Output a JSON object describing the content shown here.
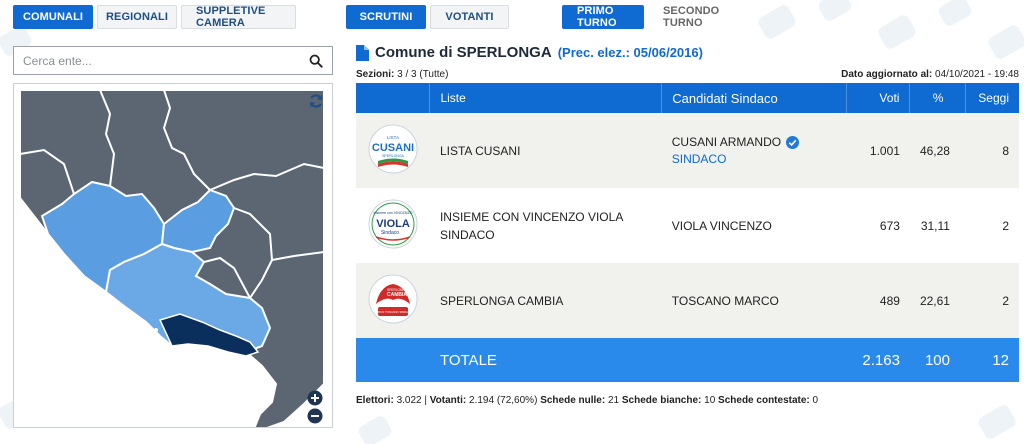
{
  "tabs_election": [
    "COMUNALI",
    "REGIONALI",
    "SUPPLETIVE CAMERA"
  ],
  "tabs_view": [
    "SCRUTINI",
    "VOTANTI"
  ],
  "tabs_round": [
    "PRIMO TURNO",
    "SECONDO TURNO"
  ],
  "search": {
    "placeholder": "Cerca ente..."
  },
  "map": {
    "icons": [
      "refresh-icon",
      "zoom-in-icon",
      "zoom-out-icon"
    ]
  },
  "header": {
    "title": "Comune di SPERLONGA",
    "previous_election": "(Prec. elez.: 05/06/2016)",
    "sections_label": "Sezioni:",
    "sections_value": "3 / 3 (Tutte)",
    "updated_label": "Dato aggiornato al:",
    "updated_value": "04/10/2021 - 19:48"
  },
  "table": {
    "columns": [
      "Liste",
      "Candidati Sindaco",
      "Voti",
      "%",
      "Seggi"
    ],
    "rows": [
      {
        "list": "LISTA CUSANI",
        "candidate": "CUSANI ARMANDO",
        "role": "SINDACO",
        "elected": true,
        "votes": "1.001",
        "percent": "46,28",
        "seats": "8",
        "logo": {
          "top": "LISTA",
          "main": "CUSANI",
          "sub": "SPERLONGA",
          "color": "#1f6fc4"
        }
      },
      {
        "list": "INSIEME CON VINCENZO VIOLA SINDACO",
        "candidate": "VIOLA VINCENZO",
        "role": "",
        "elected": false,
        "votes": "673",
        "percent": "31,11",
        "seats": "2",
        "logo": {
          "top": "Insieme con VINCENZO",
          "main": "VIOLA",
          "sub": "Sindaco",
          "color": "#1c3d7a"
        }
      },
      {
        "list": "SPERLONGA CAMBIA",
        "candidate": "TOSCANO MARCO",
        "role": "",
        "elected": false,
        "votes": "489",
        "percent": "22,61",
        "seats": "2",
        "logo": {
          "top": "SPERLONGA",
          "main": "CAMBIA",
          "sub": "MARCO TOSCANO SINDACO",
          "color": "#d02a2a"
        }
      }
    ],
    "total": {
      "label": "TOTALE",
      "votes": "2.163",
      "percent": "100",
      "seats": "12"
    }
  },
  "footer": {
    "electors_label": "Elettori:",
    "electors": "3.022",
    "voters_label": "Votanti:",
    "voters": "2.194 (72,60%)",
    "null_label": "Schede nulle:",
    "null": "21",
    "blank_label": "Schede bianche:",
    "blank": "10",
    "contested_label": "Schede contestate:",
    "contested": "0"
  },
  "colors": {
    "primary": "#0f6ad1",
    "total_bg": "#2a8aeb",
    "map_dark": "#5b6672",
    "map_light": "#5a9de0",
    "map_selected": "#0b2f5c"
  }
}
